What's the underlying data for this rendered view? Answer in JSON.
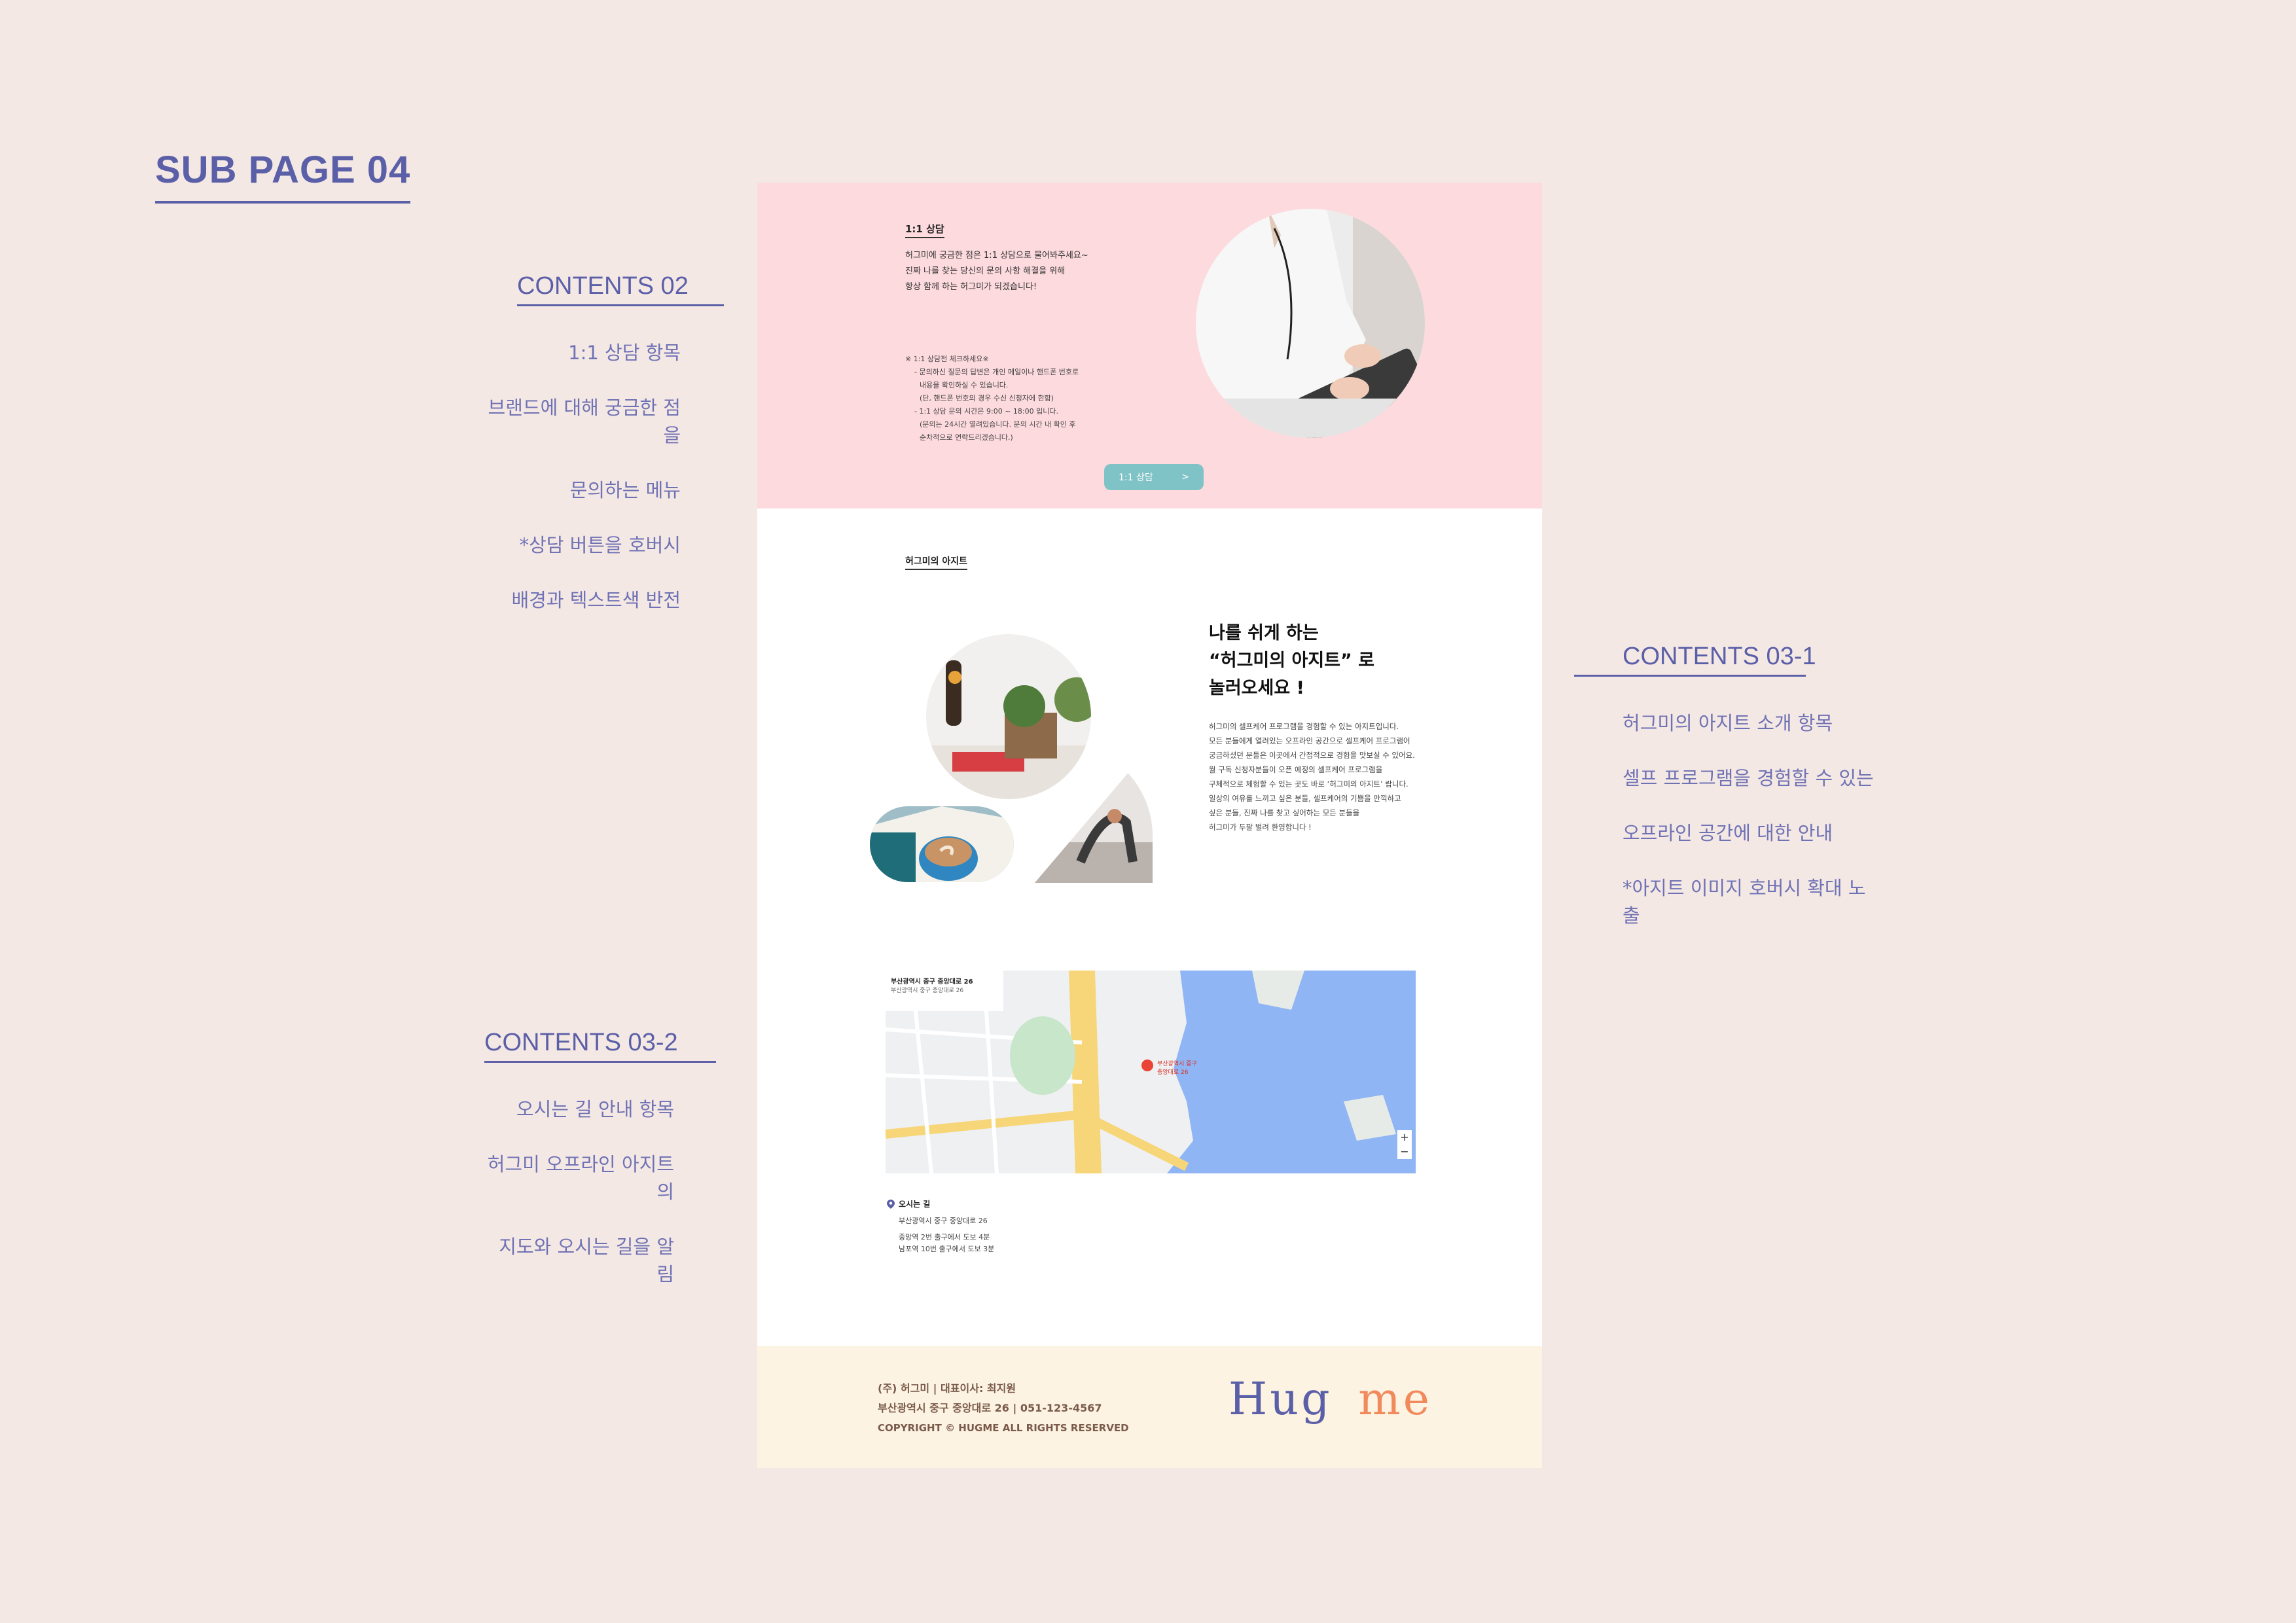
{
  "page_title": "SUB PAGE 04",
  "annotations": {
    "contents02": {
      "heading": "CONTENTS 02",
      "lines": [
        "1:1 상담 항목",
        "브랜드에 대해 궁금한 점을",
        "문의하는  메뉴",
        "*상담 버튼을 호버시",
        "배경과 텍스트색 반전"
      ]
    },
    "contents031": {
      "heading": "CONTENTS 03-1",
      "lines": [
        "허그미의 아지트 소개 항목",
        "셀프 프로그램을 경험할 수 있는",
        "오프라인 공간에 대한 안내",
        "*아지트 이미지 호버시 확대 노출"
      ]
    },
    "contents032": {
      "heading": "CONTENTS 03-2",
      "lines": [
        "오시는 길 안내 항목",
        "허그미 오프라인 아지트의",
        "지도와 오시는 길을 알림"
      ]
    }
  },
  "consult": {
    "title": "1:1 상담",
    "intro": [
      "허그미에 궁금한 점은 1:1 상담으로 물어봐주세요~",
      "진짜 나를 찾는 당신의 문의 사항 해결을 위해",
      "항상 함께 하는 허그미가 되겠습니다!"
    ],
    "notice_title": "※ 1:1 상담전 체크하세요※",
    "notice_items": [
      "- 문의하신 질문의 답변은 개인 메일이나 핸드폰 번호로",
      "  내용을 확인하실 수 있습니다.",
      "  (단, 핸드폰 번호의 경우 수신 신청자에 한함)",
      "- 1:1 상담 문의 시간은 9:00 ~ 18:00 입니다.",
      "  (문의는 24시간 열려있습니다. 문의 시간 내 확인 후",
      "  순차적으로 연락드리겠습니다.)"
    ],
    "button_label": "1:1 상담",
    "button_arrow": ">"
  },
  "azit": {
    "section_title": "허그미의 아지트",
    "headline": [
      "나를 쉬게 하는",
      "“허그미의 아지트” 로",
      "놀러오세요 !"
    ],
    "body": [
      "허그미의 셀프케어 프로그램을 경험할 수 있는 아지트입니다.",
      "모든 분들에게 열려있는 오프라인 공간으로 셀프케어 프로그램어",
      "궁금하셨던 분들은 이곳에서 간접적으로 경험을 맛보실 수 있어요.",
      "월 구독 신청자분들이 오픈 예정의 셀프케어 프로그램을",
      "구체적으로 체험할 수 있는 곳도 바로 ‘허그미의 아지트’ 랍니다.",
      "일상의 여유를 느끼고 싶은 분들, 셀프케어의 기쁨을 만끽하고",
      "싶은 분들, 진짜 나를 찾고 싶어하는 모든 분들을",
      "허그미가 두팔 벌려 환영합니다 !"
    ]
  },
  "map": {
    "place_title": "부산광역시 중구 중앙대로 26",
    "place_sub": "부산광역시 중구 중앙대로 26",
    "marker_label": "부산광역시 중구 중앙대로 26",
    "zoom_plus": "+",
    "zoom_minus": "−"
  },
  "directions": {
    "title": "오시는 길",
    "address": "부산광역시 중구 중앙대로 26",
    "routes": [
      "중앙역 2번 출구에서 도보 4분",
      "남포역 10번 출구에서 도보 3분"
    ]
  },
  "footer": {
    "line1": "(주) 허그미   |   대표이사: 최지원",
    "line2": "부산광역시 중구 중앙대로 26   |   051-123-4567",
    "line3": "COPYRIGHT © HUGME ALL RIGHTS RESERVED",
    "logo_left": "Hug",
    "logo_right": "me"
  },
  "colors": {
    "background": "#f4e8e4",
    "accent": "#5b5fa8",
    "pink_section": "#fddade",
    "footer_bg": "#fdf3e2",
    "button": "#7fc3c7",
    "map_water": "#8fb5f4"
  }
}
